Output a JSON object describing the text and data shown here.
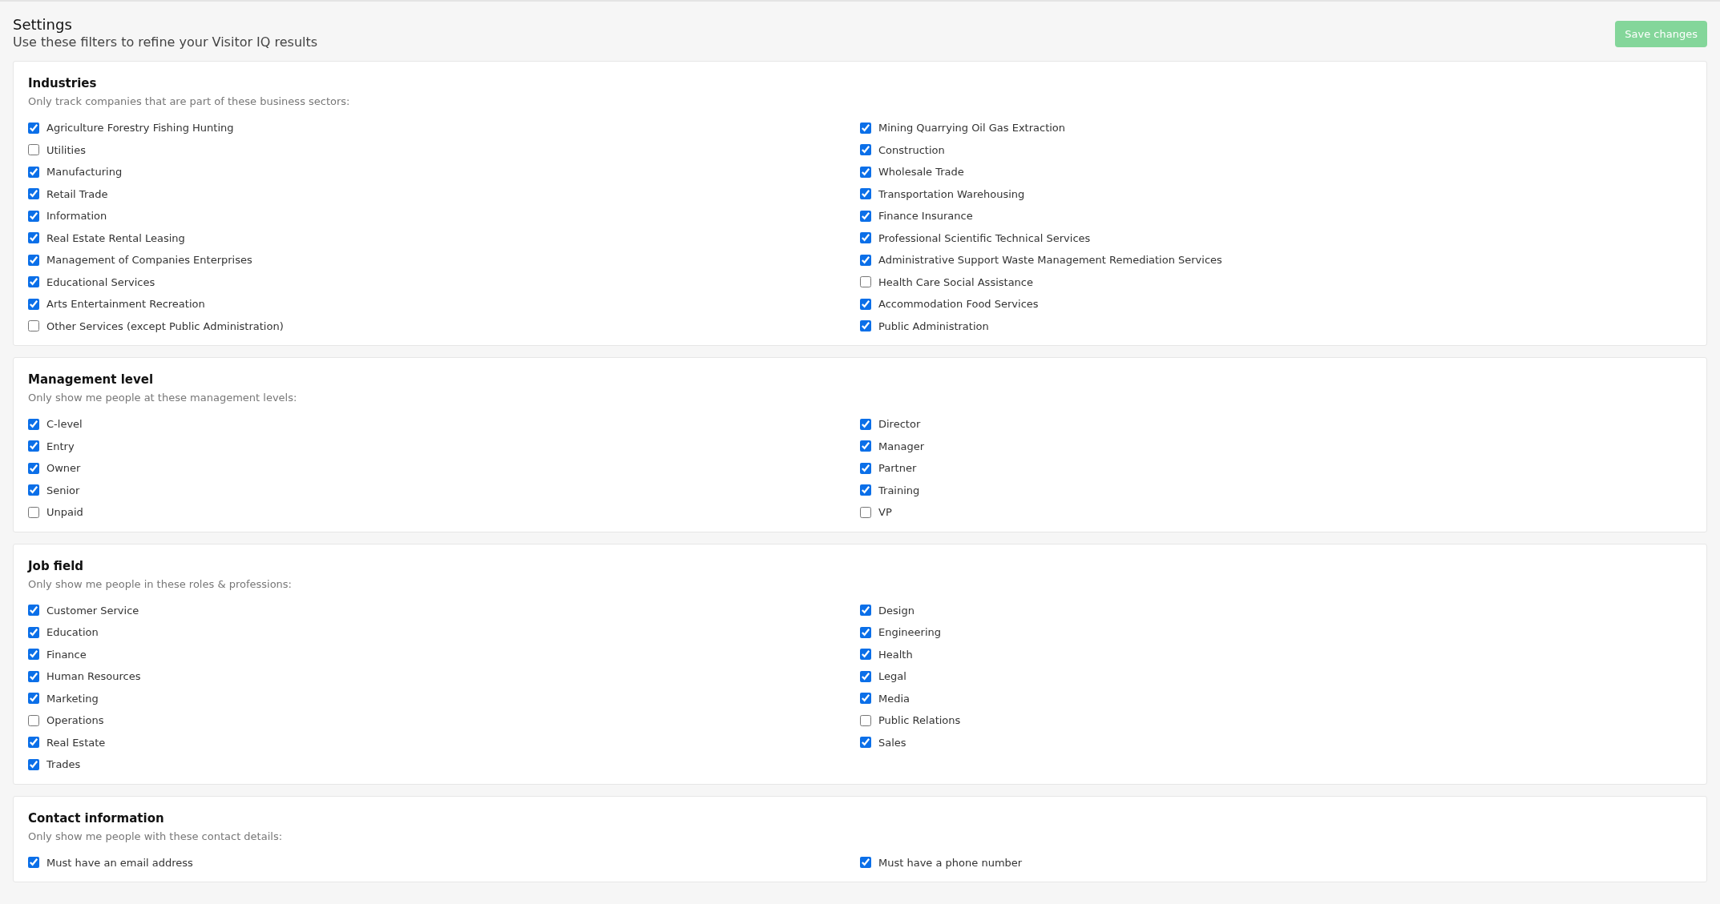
{
  "header": {
    "title": "Settings",
    "subtitle": "Use these filters to refine your Visitor IQ results",
    "save_button": "Save changes"
  },
  "sections": [
    {
      "title": "Industries",
      "description": "Only track companies that are part of these business sectors:",
      "columns": [
        [
          {
            "label": "Agriculture Forestry Fishing Hunting",
            "checked": true
          },
          {
            "label": "Utilities",
            "checked": false
          },
          {
            "label": "Manufacturing",
            "checked": true
          },
          {
            "label": "Retail Trade",
            "checked": true
          },
          {
            "label": "Information",
            "checked": true
          },
          {
            "label": "Real Estate Rental Leasing",
            "checked": true
          },
          {
            "label": "Management of Companies Enterprises",
            "checked": true
          },
          {
            "label": "Educational Services",
            "checked": true
          },
          {
            "label": "Arts Entertainment Recreation",
            "checked": true
          },
          {
            "label": "Other Services (except Public Administration)",
            "checked": false
          }
        ],
        [
          {
            "label": "Mining Quarrying Oil Gas Extraction",
            "checked": true
          },
          {
            "label": "Construction",
            "checked": true
          },
          {
            "label": "Wholesale Trade",
            "checked": true
          },
          {
            "label": "Transportation Warehousing",
            "checked": true
          },
          {
            "label": "Finance Insurance",
            "checked": true
          },
          {
            "label": "Professional Scientific Technical Services",
            "checked": true
          },
          {
            "label": "Administrative Support Waste Management Remediation Services",
            "checked": true
          },
          {
            "label": "Health Care Social Assistance",
            "checked": false
          },
          {
            "label": "Accommodation Food Services",
            "checked": true
          },
          {
            "label": "Public Administration",
            "checked": true
          }
        ]
      ]
    },
    {
      "title": "Management level",
      "description": "Only show me people at these management levels:",
      "columns": [
        [
          {
            "label": "C-level",
            "checked": true
          },
          {
            "label": "Entry",
            "checked": true
          },
          {
            "label": "Owner",
            "checked": true
          },
          {
            "label": "Senior",
            "checked": true
          },
          {
            "label": "Unpaid",
            "checked": false
          }
        ],
        [
          {
            "label": "Director",
            "checked": true
          },
          {
            "label": "Manager",
            "checked": true
          },
          {
            "label": "Partner",
            "checked": true
          },
          {
            "label": "Training",
            "checked": true
          },
          {
            "label": "VP",
            "checked": false
          }
        ]
      ]
    },
    {
      "title": "Job field",
      "description": "Only show me people in these roles & professions:",
      "columns": [
        [
          {
            "label": "Customer Service",
            "checked": true
          },
          {
            "label": "Education",
            "checked": true
          },
          {
            "label": "Finance",
            "checked": true
          },
          {
            "label": "Human Resources",
            "checked": true
          },
          {
            "label": "Marketing",
            "checked": true
          },
          {
            "label": "Operations",
            "checked": false
          },
          {
            "label": "Real Estate",
            "checked": true
          },
          {
            "label": "Trades",
            "checked": true
          }
        ],
        [
          {
            "label": "Design",
            "checked": true
          },
          {
            "label": "Engineering",
            "checked": true
          },
          {
            "label": "Health",
            "checked": true
          },
          {
            "label": "Legal",
            "checked": true
          },
          {
            "label": "Media",
            "checked": true
          },
          {
            "label": "Public Relations",
            "checked": false
          },
          {
            "label": "Sales",
            "checked": true
          }
        ]
      ]
    },
    {
      "title": "Contact information",
      "description": "Only show me people with these contact details:",
      "columns": [
        [
          {
            "label": "Must have an email address",
            "checked": true
          }
        ],
        [
          {
            "label": "Must have a phone number",
            "checked": true
          }
        ]
      ]
    }
  ]
}
